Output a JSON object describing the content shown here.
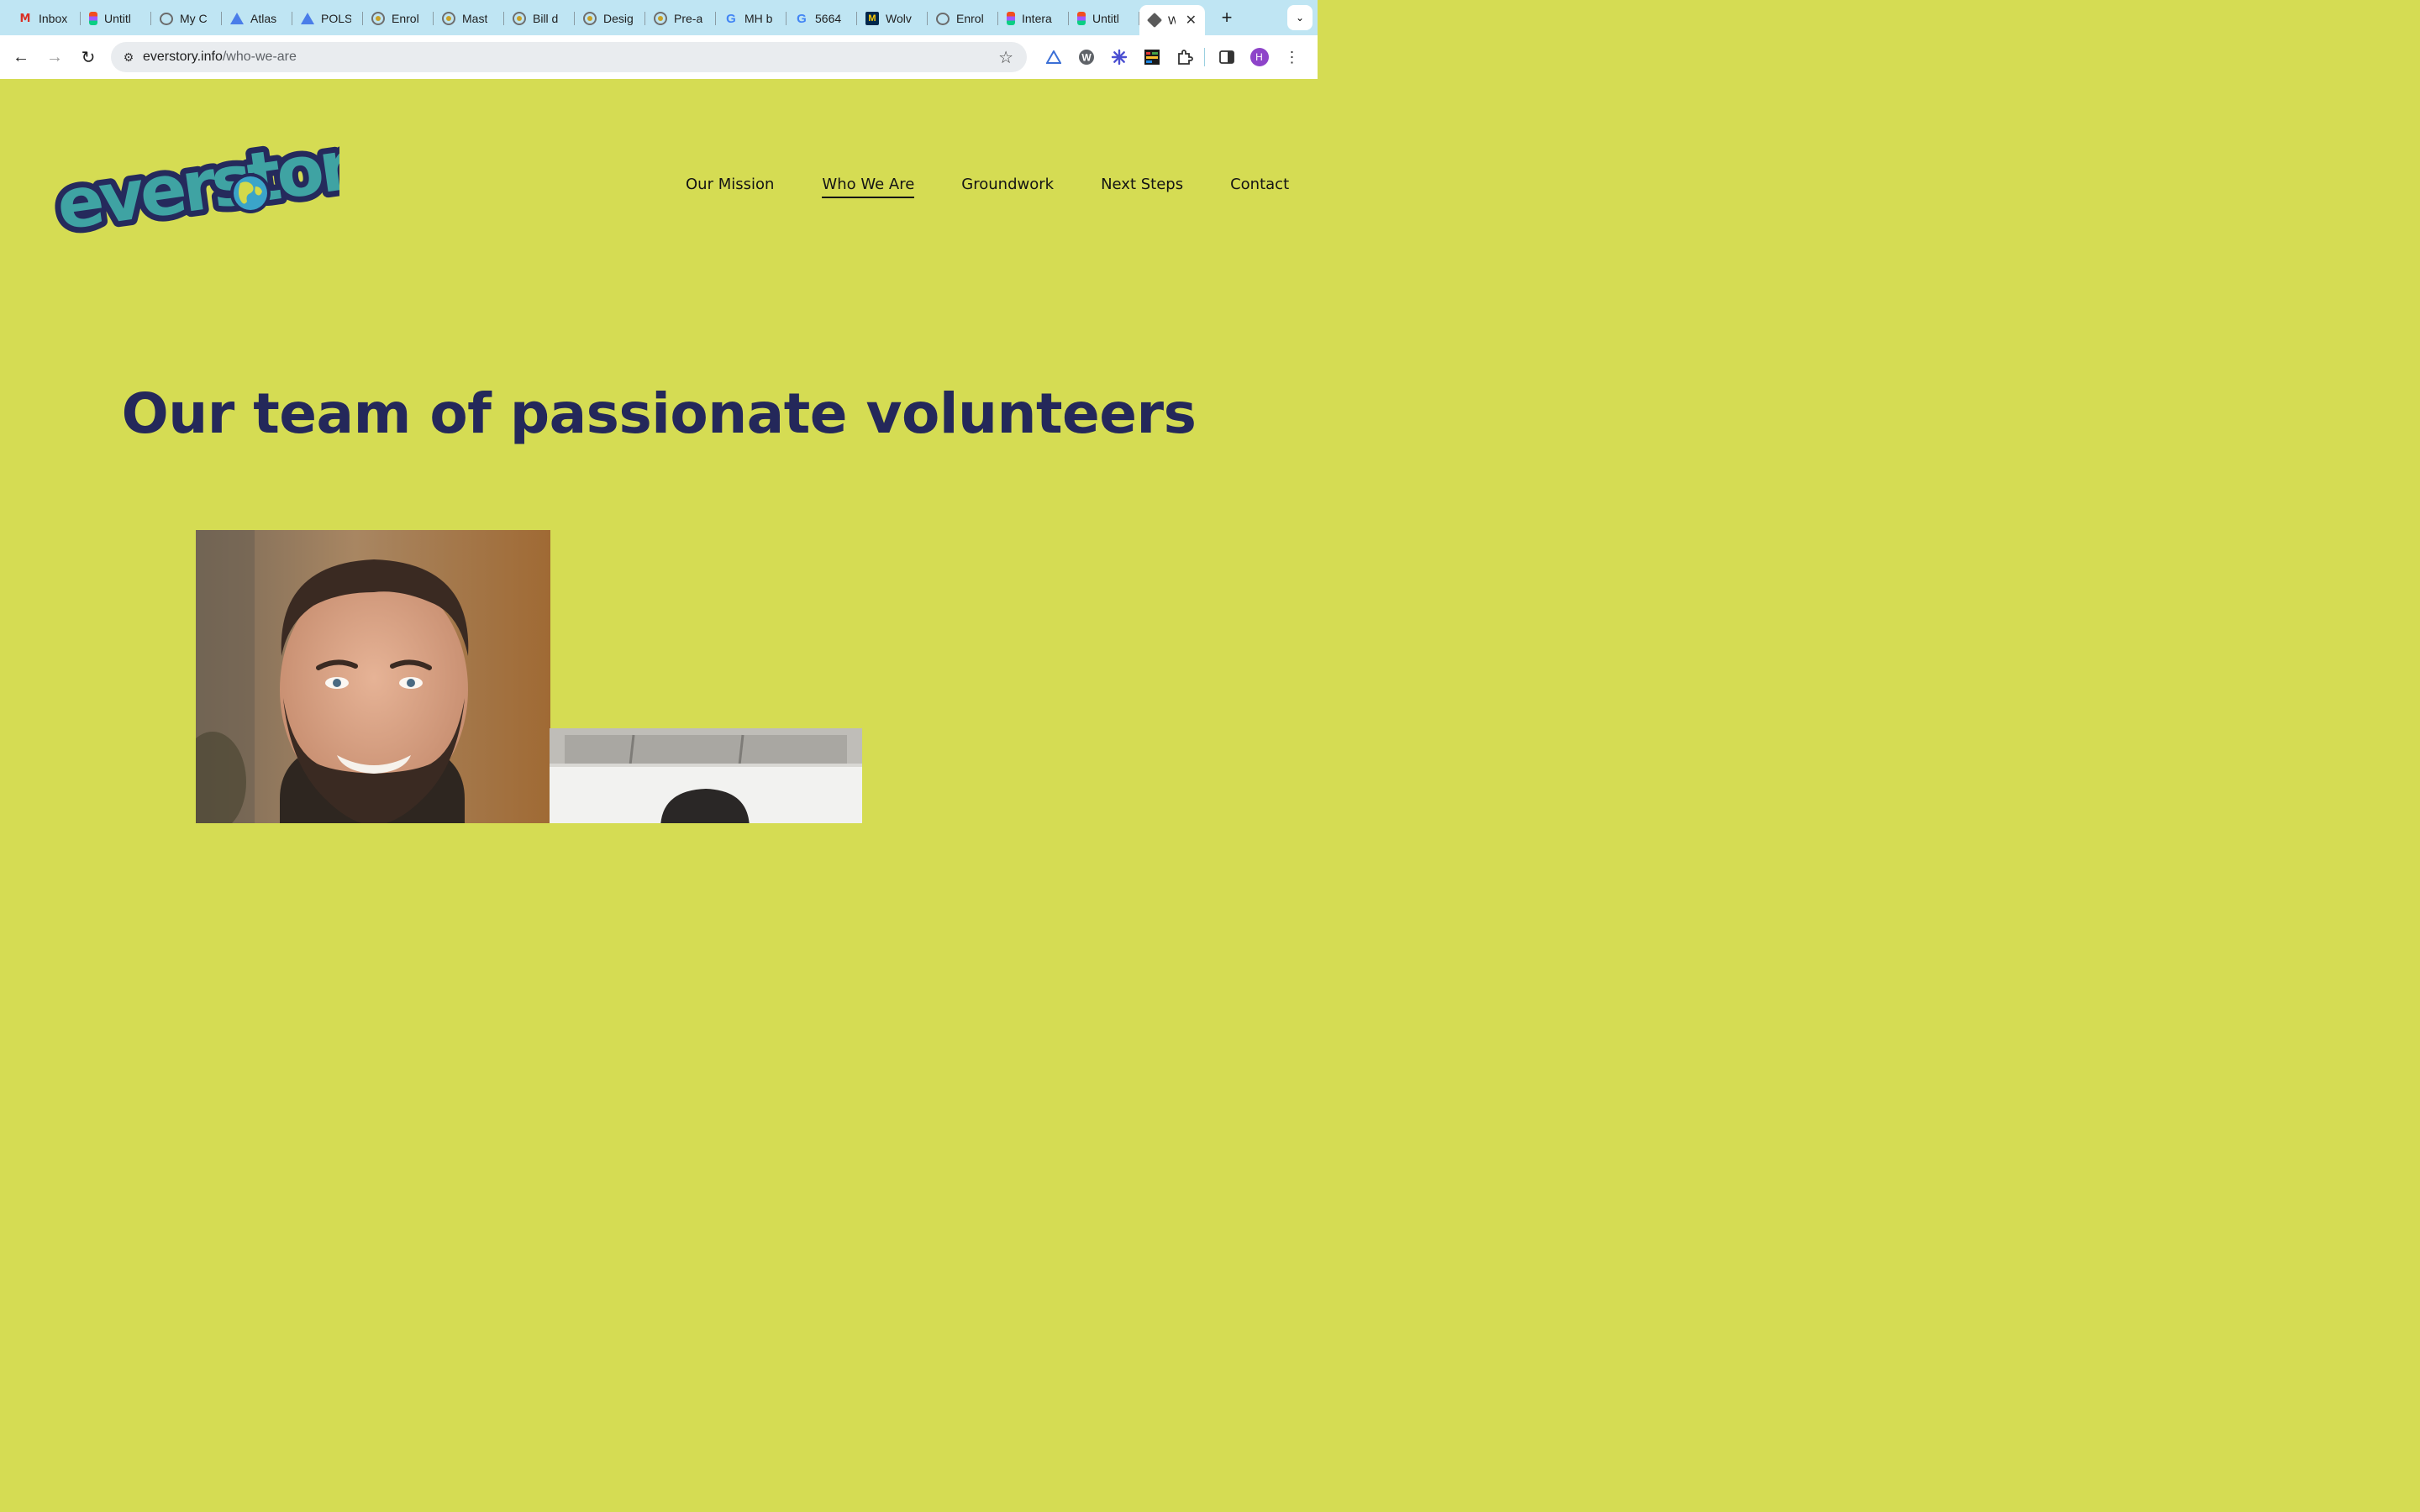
{
  "browser": {
    "tabs": [
      {
        "title": "Inbox",
        "icon": "gmail-icon"
      },
      {
        "title": "Untitl",
        "icon": "figma-icon"
      },
      {
        "title": "My C",
        "icon": "globe-icon"
      },
      {
        "title": "Atlas",
        "icon": "atlas-icon"
      },
      {
        "title": "POLS",
        "icon": "atlas-icon"
      },
      {
        "title": "Enrol",
        "icon": "circle-logo-icon"
      },
      {
        "title": "Mast",
        "icon": "circle-logo-icon"
      },
      {
        "title": "Bill d",
        "icon": "circle-logo-icon"
      },
      {
        "title": "Desig",
        "icon": "circle-logo-icon"
      },
      {
        "title": "Pre-a",
        "icon": "circle-logo-icon"
      },
      {
        "title": "MH b",
        "icon": "google-icon"
      },
      {
        "title": "5664",
        "icon": "google-icon"
      },
      {
        "title": "Wolv",
        "icon": "michigan-icon"
      },
      {
        "title": "Enrol",
        "icon": "globe-icon"
      },
      {
        "title": "Intera",
        "icon": "figma-icon"
      },
      {
        "title": "Untitl",
        "icon": "figma-icon"
      }
    ],
    "active_tab": {
      "title": "W",
      "icon": "box-icon"
    },
    "new_tab_label": "+",
    "url_host": "everstory.info",
    "url_path": "/who-we-are"
  },
  "site": {
    "logo_text": "everstory",
    "nav": {
      "our_mission": "Our Mission",
      "who_we_are": "Who We Are",
      "groundwork": "Groundwork",
      "next_steps": "Next Steps",
      "contact": "Contact"
    },
    "hero_title": "Our team of passionate volunteers"
  },
  "colors": {
    "page_background": "#d5dc53",
    "heading": "#24285a",
    "logo_teal": "#3fa3a3",
    "logo_outline": "#252a5c",
    "tabstrip": "#bfe5f3"
  }
}
